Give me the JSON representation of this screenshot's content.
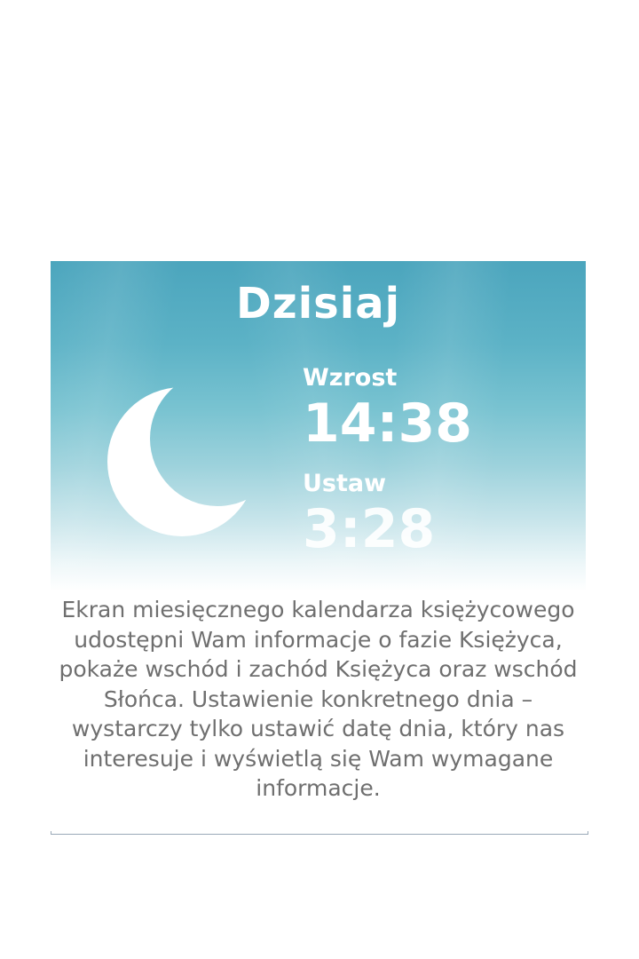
{
  "screen": {
    "title": "Dzisiaj",
    "rise_label": "Wzrost",
    "rise_time": "14:38",
    "set_label": "Ustaw",
    "set_time": "3:28",
    "moon_icon": "crescent-moon-icon"
  },
  "description": "Ekran miesięcznego kalendarza księżycowego udostępni Wam informacje o fazie Księżyca, pokaże wschód i zachód Księżyca oraz wschód Słońca. Ustawienie konkretnego dnia – wystarczy tylko ustawić datę dnia, który nas interesuje i wyświetlą się Wam wymagane informacje.",
  "colors": {
    "sky_top": "#4ba5bd",
    "sky_bottom": "#ffffff",
    "text_gray": "#6f6f6f",
    "divider": "#9aa9b8"
  }
}
